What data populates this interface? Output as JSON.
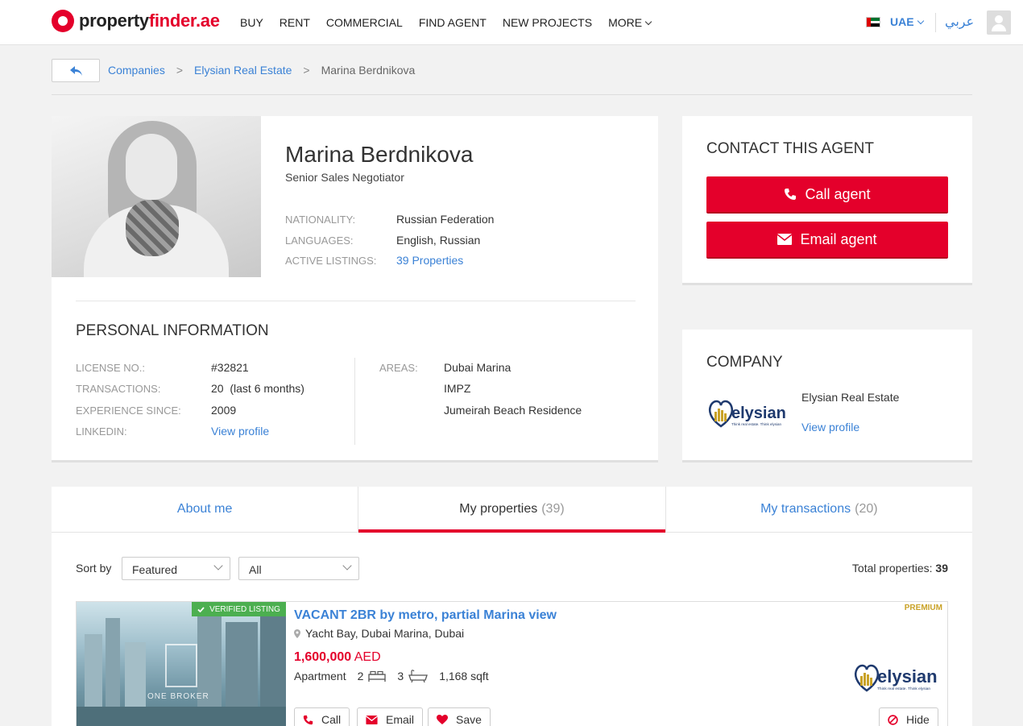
{
  "header": {
    "logo_part1": "property",
    "logo_part2": "finder.ae",
    "nav": [
      "BUY",
      "RENT",
      "COMMERCIAL",
      "FIND AGENT",
      "NEW PROJECTS",
      "MORE"
    ],
    "country": "UAE",
    "language": "عربي"
  },
  "breadcrumb": {
    "items": [
      "Companies",
      "Elysian Real Estate"
    ],
    "current": "Marina Berdnikova",
    "separator": ">"
  },
  "agent": {
    "name": "Marina Berdnikova",
    "title": "Senior Sales Negotiator",
    "details": [
      {
        "label": "NATIONALITY:",
        "value": "Russian Federation"
      },
      {
        "label": "LANGUAGES:",
        "value": "English, Russian"
      },
      {
        "label": "ACTIVE LISTINGS:",
        "value": "39 Properties"
      }
    ]
  },
  "personal_info": {
    "heading": "PERSONAL INFORMATION",
    "left": [
      {
        "label": "LICENSE NO.:",
        "value": "#32821"
      },
      {
        "label": "TRANSACTIONS:",
        "value": "20  (last 6 months)"
      },
      {
        "label": "EXPERIENCE SINCE:",
        "value": "2009"
      },
      {
        "label": "LINKEDIN:",
        "value": "View profile"
      }
    ],
    "areas_label": "AREAS:",
    "areas": [
      "Dubai Marina",
      "IMPZ",
      "Jumeirah Beach Residence"
    ]
  },
  "contact": {
    "heading": "CONTACT THIS AGENT",
    "call_label": "Call agent",
    "email_label": "Email agent"
  },
  "company": {
    "heading": "COMPANY",
    "name": "Elysian Real Estate",
    "view_profile": "View profile",
    "logo_text": "elysian",
    "logo_tagline": "Think real estate. Think elysian"
  },
  "tabs": [
    {
      "label": "About me",
      "count": ""
    },
    {
      "label": "My properties",
      "count": "(39)"
    },
    {
      "label": "My transactions",
      "count": "(20)"
    }
  ],
  "listing_controls": {
    "sort_label": "Sort by",
    "sort_value": "Featured",
    "filter_value": "All",
    "total_label": "Total properties:",
    "total_value": "39"
  },
  "listing": {
    "badge": "VERIFIED LISTING",
    "watermark": "ONE BROKER",
    "premium": "PREMIUM",
    "title": "VACANT 2BR by metro, partial Marina view",
    "location": "Yacht Bay, Dubai Marina, Dubai",
    "price": "1,600,000",
    "currency": "AED",
    "type": "Apartment",
    "bedrooms": "2",
    "bathrooms": "3",
    "area": "1,168 sqft",
    "actions": {
      "call": "Call",
      "email": "Email",
      "save": "Save",
      "hide": "Hide"
    }
  },
  "colors": {
    "brand_red": "#e4002b",
    "link_blue": "#3b82d6",
    "verified_green": "#4caf50",
    "premium_gold": "#c9a227"
  }
}
